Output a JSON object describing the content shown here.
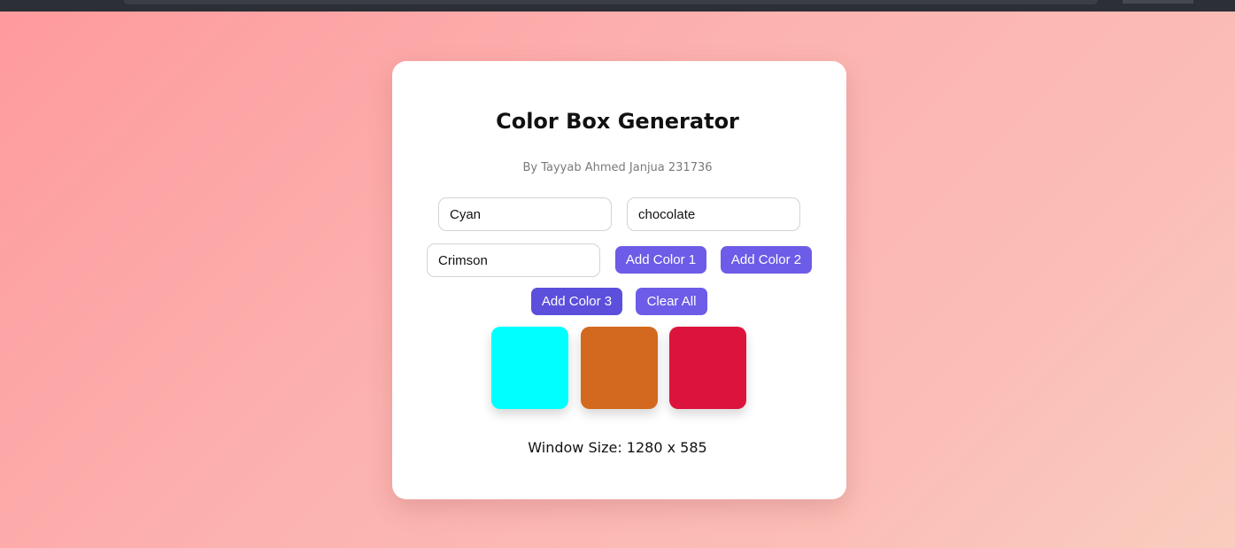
{
  "app": {
    "title": "Color Box Generator",
    "subtitle": "By Tayyab Ahmed Janjua 231736"
  },
  "inputs": [
    {
      "value": "Cyan"
    },
    {
      "value": "chocolate"
    },
    {
      "value": "Crimson"
    }
  ],
  "buttons": {
    "add_color_1": "Add Color 1",
    "add_color_2": "Add Color 2",
    "add_color_3": "Add Color 3",
    "clear_all": "Clear All"
  },
  "boxes": [
    {
      "color": "#00ffff"
    },
    {
      "color": "#d2691e"
    },
    {
      "color": "#dc143c"
    }
  ],
  "status": {
    "window_size": "Window Size: 1280 x 585"
  },
  "colors": {
    "accent": "#6c5ce7",
    "background_start": "#fe9a9e",
    "background_end": "#f9cdbf",
    "card": "#ffffff"
  }
}
